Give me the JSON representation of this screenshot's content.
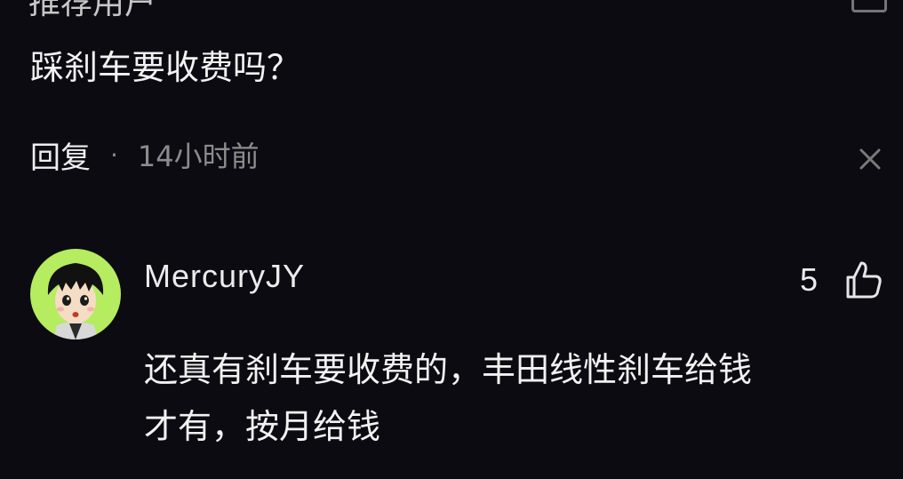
{
  "previous_comment": {
    "username_partial": "推荐用户",
    "text": "踩刹车要收费吗？",
    "reply_label": "回复",
    "separator": "·",
    "time": "14小时前"
  },
  "reply": {
    "username": "MercuryJY",
    "likes": "5",
    "text_lines": [
      "还真有刹车要收费的，丰田线性刹车给钱",
      "才有，按月给钱"
    ],
    "avatar_bg": "#b5ec60"
  },
  "icons": {
    "dismiss": "close-icon",
    "like": "thumbs-up-icon",
    "avatar": "avatar"
  },
  "colors": {
    "background": "#0c0b12",
    "text": "#f2f2f2",
    "muted": "#8c8c8c"
  }
}
